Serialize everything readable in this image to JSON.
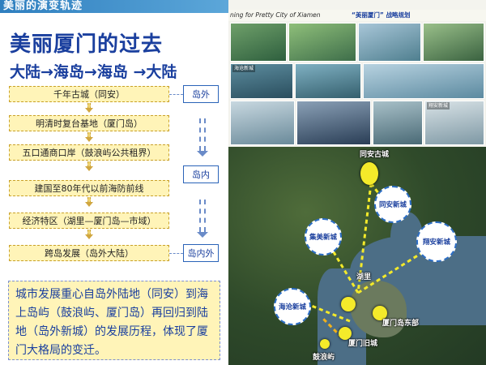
{
  "banner": {
    "title": "美丽的演变轨迹"
  },
  "left": {
    "title": "美丽厦门的过去",
    "subtitle": "大陆→海岛→海岛 →大陆",
    "stages": [
      "千年古城（同安）",
      "明清时复台基地（厦门岛）",
      "五口通商口岸（鼓浪屿公共租界）",
      "建国至80年代以前海防前线",
      "经济特区（湖里—厦门岛—市域）",
      "跨岛发展（岛外大陆）"
    ],
    "tags": [
      "岛外",
      "岛内",
      "岛内外"
    ],
    "summary": "城市发展重心自岛外陆地（同安）到海上岛屿（鼓浪屿、厦门岛）再回归到陆地（岛外新城）的发展历程，体现了厦门大格局的变迁。"
  },
  "right": {
    "header_en": "ning for Pretty City of Xiamen",
    "header_cn": "“美丽厦门” 战略规划",
    "photo_labels": [
      "海沧新城",
      "翔安新城"
    ],
    "map": {
      "top_label": "同安古城",
      "circles": [
        "同安新城",
        "集美新城",
        "翔安新城",
        "海沧新城"
      ],
      "labels": [
        "湖里",
        "厦门岛东部",
        "厦门旧城",
        "鼓浪屿"
      ]
    }
  },
  "colors": {
    "accent": "#1a3f9e",
    "box_fill": "#fff4b8",
    "banner": "#2f7fbf",
    "dot": "#f4ea2a"
  }
}
